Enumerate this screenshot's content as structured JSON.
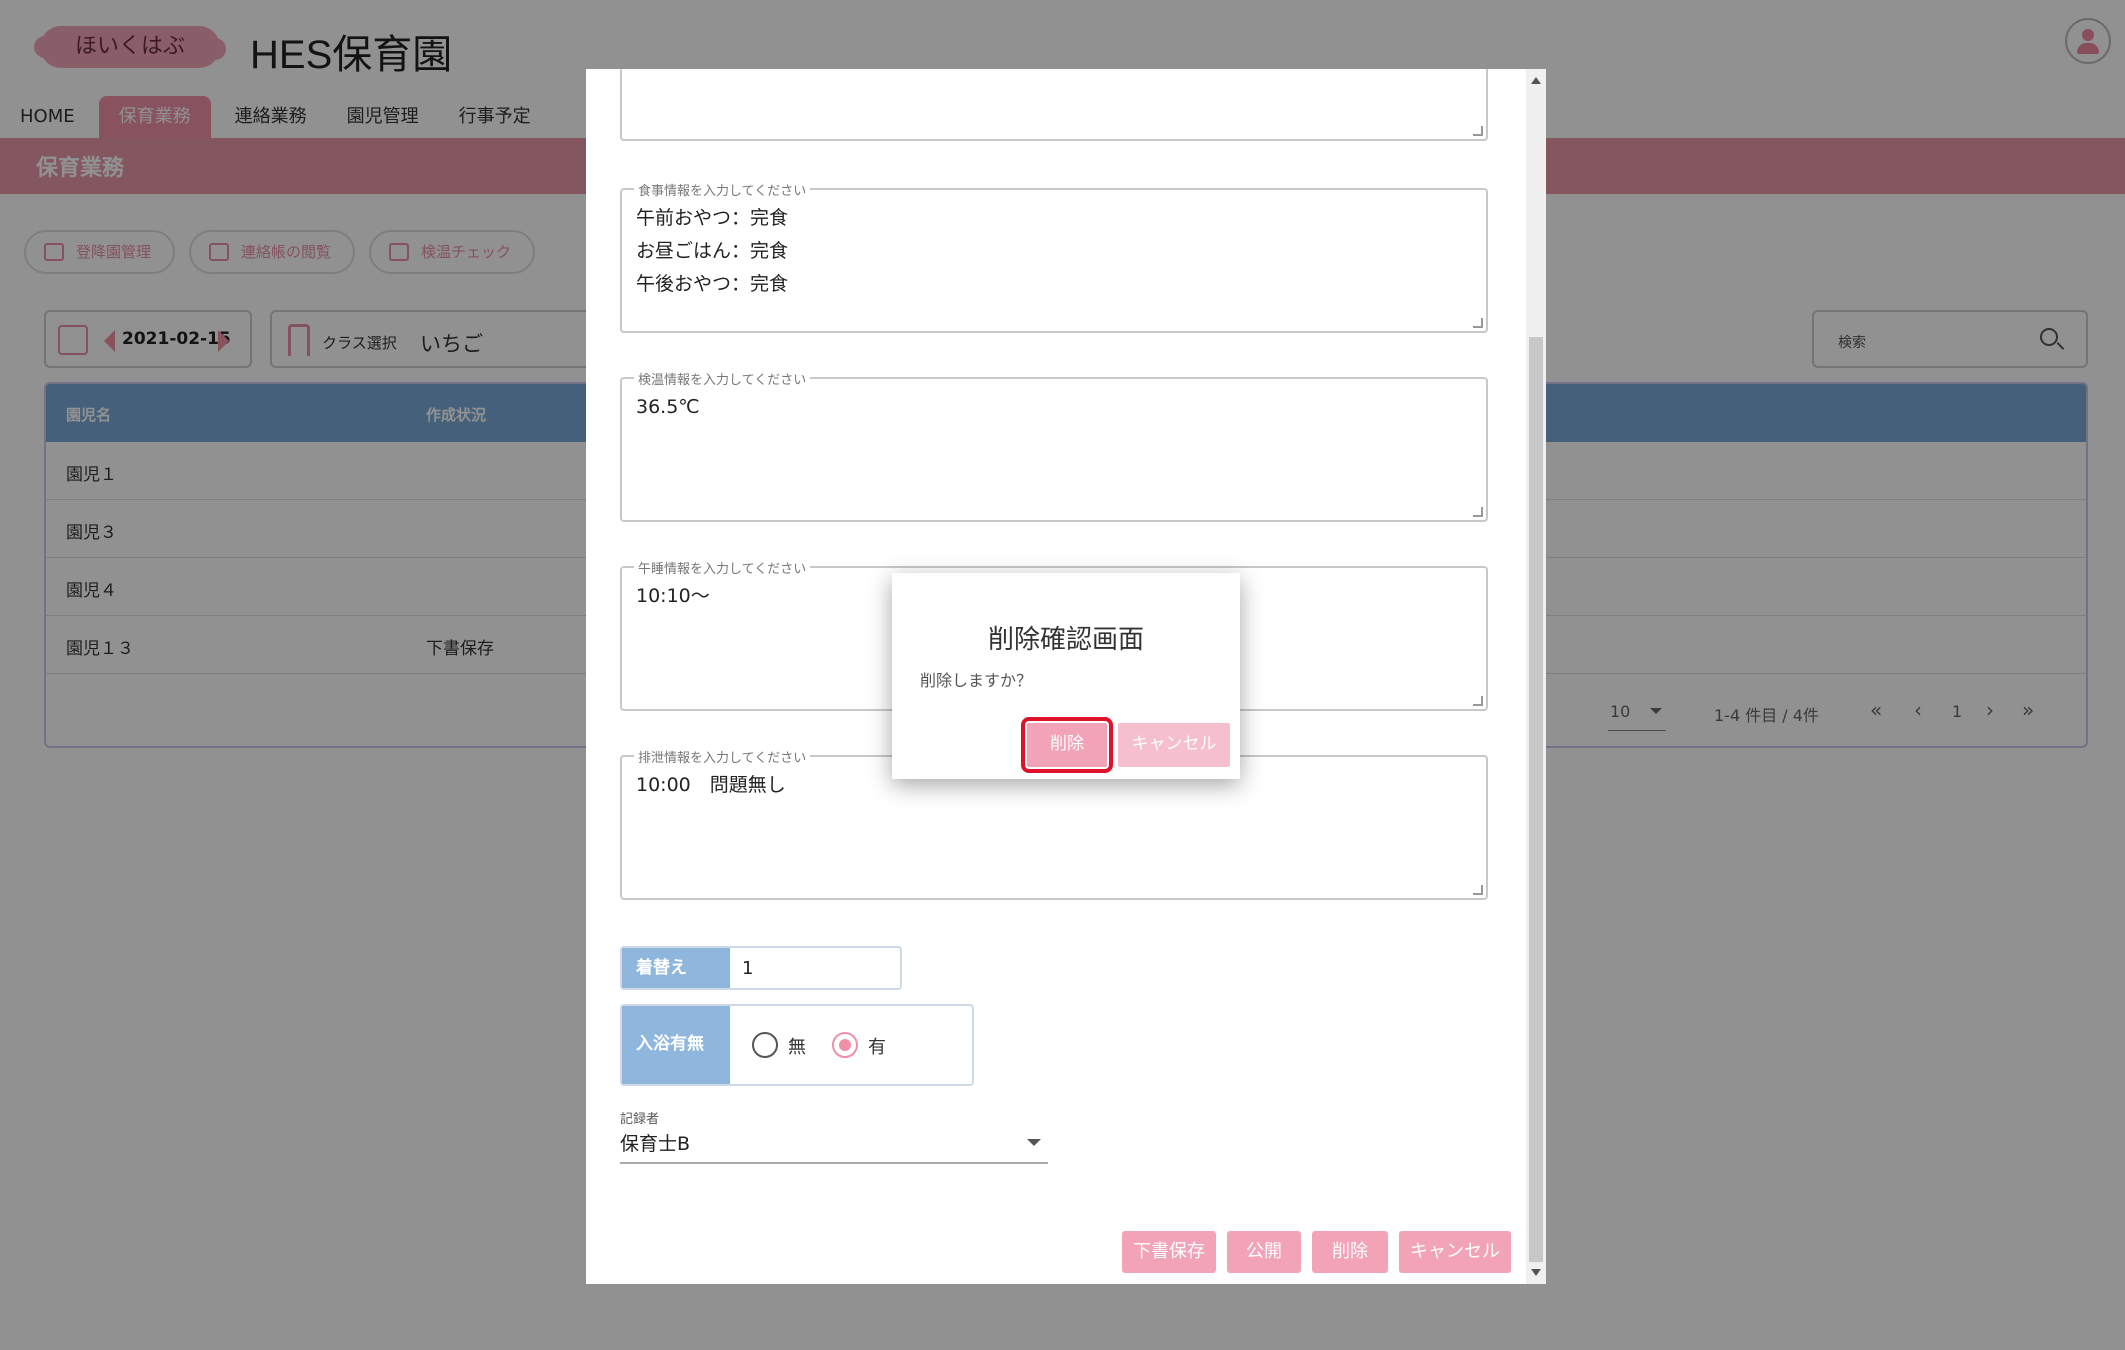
{
  "header": {
    "logo_text": "ほいくはぶ",
    "app_title": "HES保育園"
  },
  "nav": {
    "tabs": [
      {
        "label": "HOME",
        "active": false
      },
      {
        "label": "保育業務",
        "active": true
      },
      {
        "label": "連絡業務",
        "active": false
      },
      {
        "label": "園児管理",
        "active": false
      },
      {
        "label": "行事予定",
        "active": false
      }
    ]
  },
  "section": {
    "title": "保育業務"
  },
  "function_buttons": [
    "登降園管理",
    "連絡帳の閲覧",
    "検温チェック"
  ],
  "filters": {
    "date": "2021-02-15",
    "class_label": "クラス選択",
    "class_value": "いちご",
    "search_placeholder": "検索"
  },
  "table": {
    "headers": [
      "園児名",
      "作成状況"
    ],
    "rows": [
      {
        "name": "園児１",
        "status": ""
      },
      {
        "name": "園児３",
        "status": ""
      },
      {
        "name": "園児４",
        "status": ""
      },
      {
        "name": "園児１３",
        "status": "下書保存"
      }
    ],
    "pager": {
      "per_page": "10",
      "range": "1-4 件目 / 4件",
      "first": "«",
      "prev": "‹",
      "page": "1",
      "next": "›",
      "last": "»"
    }
  },
  "form": {
    "meal": {
      "legend": "食事情報を入力してください",
      "lines": [
        "午前おやつ：完食",
        "お昼ごはん：完食",
        "午後おやつ：完食"
      ]
    },
    "temperature": {
      "legend": "検温情報を入力してください",
      "lines": [
        "36.5℃"
      ]
    },
    "nap": {
      "legend": "午睡情報を入力してください",
      "lines": [
        "10:10～"
      ]
    },
    "excretion": {
      "legend": "排泄情報を入力してください",
      "lines": [
        "10:00　問題無し"
      ]
    },
    "kigae": {
      "label": "着替え",
      "value": "1"
    },
    "bath": {
      "label": "入浴有無",
      "option_no": "無",
      "option_yes": "有",
      "selected": "有"
    },
    "recorder": {
      "label": "記録者",
      "value": "保育士B"
    },
    "buttons": {
      "draft": "下書保存",
      "publish": "公開",
      "delete": "削除",
      "cancel": "キャンセル"
    }
  },
  "dialog": {
    "title": "削除確認画面",
    "message": "削除しますか？",
    "delete_label": "削除",
    "cancel_label": "キャンセル"
  },
  "colors": {
    "accent_pink": "#f090a8",
    "button_pink": "#f2a3b8",
    "header_blue": "#7aaad6",
    "highlight_red": "#e0112b"
  }
}
